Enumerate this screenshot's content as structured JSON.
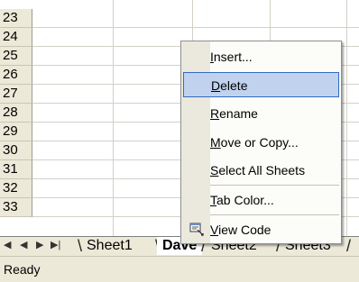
{
  "rows": [
    "23",
    "24",
    "25",
    "26",
    "27",
    "28",
    "29",
    "30",
    "31",
    "32",
    "33"
  ],
  "menu": {
    "items": [
      {
        "pre": "",
        "u": "I",
        "post": "nsert..."
      },
      {
        "pre": "",
        "u": "D",
        "post": "elete"
      },
      {
        "pre": "",
        "u": "R",
        "post": "ename"
      },
      {
        "pre": "",
        "u": "M",
        "post": "ove or Copy..."
      },
      {
        "pre": "",
        "u": "S",
        "post": "elect All Sheets"
      },
      {
        "pre": "",
        "u": "T",
        "post": "ab Color..."
      },
      {
        "pre": "",
        "u": "V",
        "post": "iew Code"
      }
    ]
  },
  "tabs": [
    "Sheet1",
    "Dave",
    "Sheet2",
    "Sheet3"
  ],
  "status": {
    "text": "Ready"
  },
  "colors": {
    "highlight": "#c1d2ee",
    "highlight_border": "#316ac5",
    "chrome": "#ece9d8"
  }
}
